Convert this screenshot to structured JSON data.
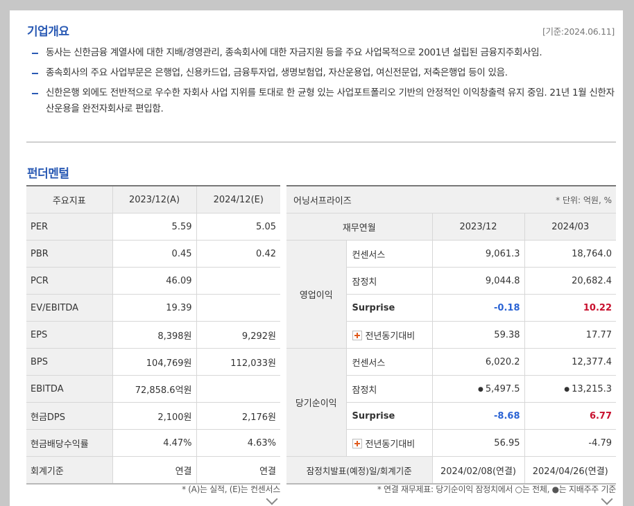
{
  "overview": {
    "title": "기업개요",
    "date_label": "[기준:2024.06.11]",
    "items": [
      "동사는 신한금융 계열사에 대한 지배/경영관리, 종속회사에 대한 자금지원 등을 주요 사업목적으로 2001년 설립된 금융지주회사임.",
      "종속회사의 주요 사업부문은 은행업, 신용카드업, 금융투자업, 생명보험업, 자산운용업, 여신전문업, 저축은행업 등이 있음.",
      "신한은행 외에도 전반적으로 우수한 자회사 사업 지위를 토대로 한 균형 있는 사업포트폴리오 기반의 안정적인 이익창출력 유지 중임. 21년 1월 신한자산운용을 완전자회사로 편입함."
    ]
  },
  "fundamental": {
    "title": "펀더멘털",
    "left_table": {
      "headers": [
        "주요지표",
        "2023/12(A)",
        "2024/12(E)"
      ],
      "rows": [
        {
          "label": "PER",
          "v1": "5.59",
          "v2": "5.05"
        },
        {
          "label": "PBR",
          "v1": "0.45",
          "v2": "0.42"
        },
        {
          "label": "PCR",
          "v1": "46.09",
          "v2": ""
        },
        {
          "label": "EV/EBITDA",
          "v1": "19.39",
          "v2": ""
        },
        {
          "label": "EPS",
          "v1": "8,398원",
          "v2": "9,292원"
        },
        {
          "label": "BPS",
          "v1": "104,769원",
          "v2": "112,033원"
        },
        {
          "label": "EBITDA",
          "v1": "72,858.6억원",
          "v2": ""
        },
        {
          "label": "현금DPS",
          "v1": "2,100원",
          "v2": "2,176원"
        },
        {
          "label": "현금배당수익률",
          "v1": "4.47%",
          "v2": "4.63%"
        },
        {
          "label": "회계기준",
          "v1": "연결",
          "v2": "연결"
        }
      ],
      "note": "* (A)는 실적, (E)는 컨센서스"
    },
    "right_table": {
      "title": "어닝서프라이즈",
      "unit": "* 단위: 억원, %",
      "col_header": "재무연월",
      "periods": [
        "2023/12",
        "2024/03"
      ],
      "groups": [
        {
          "name": "영업이익",
          "rows": [
            {
              "label": "컨센서스",
              "v1": "9,061.3",
              "v2": "18,764.0"
            },
            {
              "label": "잠정치",
              "v1": "9,044.8",
              "v2": "20,682.4"
            },
            {
              "label": "Surprise",
              "v1": "-0.18",
              "v2": "10.22"
            },
            {
              "label": "전년동기대비",
              "v1": "59.38",
              "v2": "17.77"
            }
          ]
        },
        {
          "name": "당기순이익",
          "rows": [
            {
              "label": "컨센서스",
              "v1": "6,020.2",
              "v2": "12,377.4"
            },
            {
              "label": "잠정치",
              "v1": "5,497.5",
              "v2": "13,215.3"
            },
            {
              "label": "Surprise",
              "v1": "-8.68",
              "v2": "6.77"
            },
            {
              "label": "전년동기대비",
              "v1": "56.95",
              "v2": "-4.79"
            }
          ]
        }
      ],
      "footer": {
        "label": "잠정치발표(예정)일/회계기준",
        "v1": "2024/02/08(연결)",
        "v2": "2024/04/26(연결)"
      },
      "bullet_glyph": "●",
      "note": "* 연결 재무제표: 당기순이익 잠정치에서 ○는 전체, ●는 지배주주 기준"
    }
  },
  "colors": {
    "accent": "#2a5ab4",
    "negative": "#2a63d4",
    "positive": "#c8102e"
  }
}
